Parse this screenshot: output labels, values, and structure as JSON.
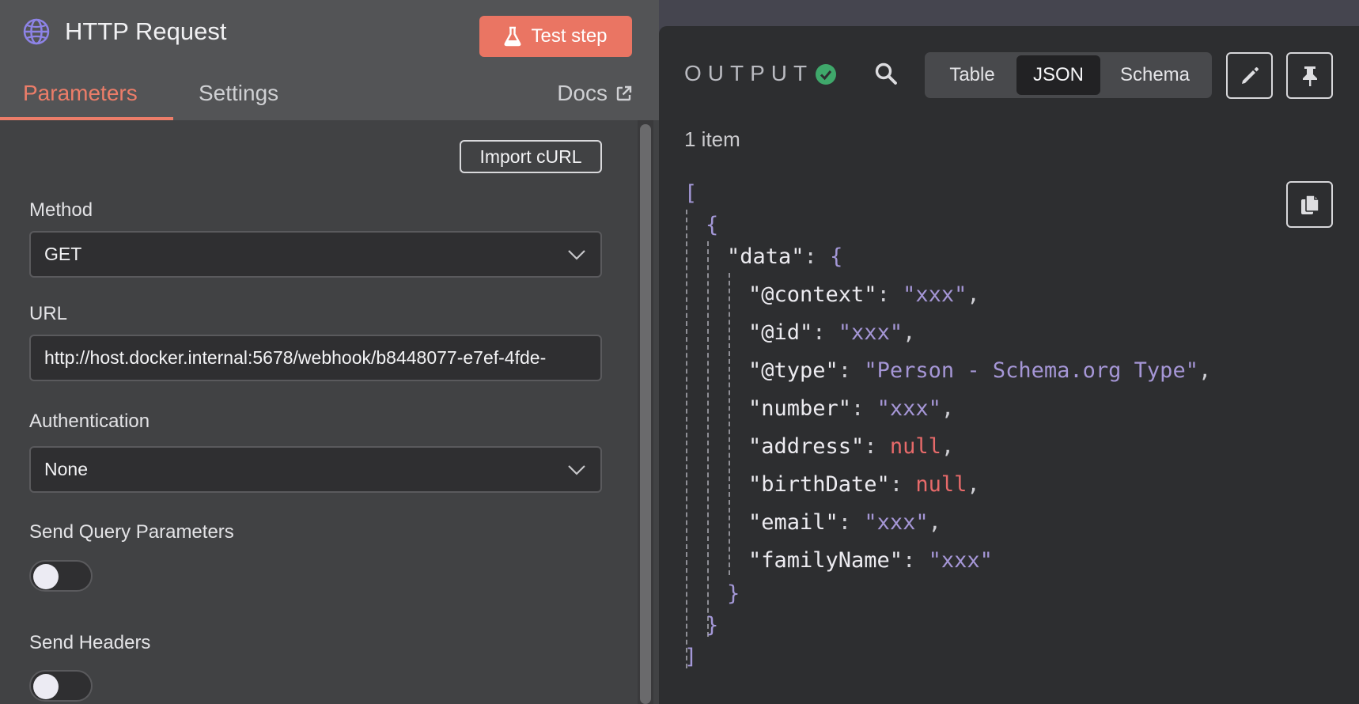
{
  "node": {
    "title": "HTTP Request",
    "test_button": "Test step",
    "tabs": {
      "parameters": "Parameters",
      "settings": "Settings",
      "docs": "Docs"
    }
  },
  "params": {
    "import_curl": "Import cURL",
    "method_label": "Method",
    "method_value": "GET",
    "url_label": "URL",
    "url_value": "http://host.docker.internal:5678/webhook/b8448077-e7ef-4fde-",
    "auth_label": "Authentication",
    "auth_value": "None",
    "query_label": "Send Query Parameters",
    "headers_label": "Send Headers"
  },
  "output": {
    "label": "OUTPUT",
    "views": {
      "table": "Table",
      "json": "JSON",
      "schema": "Schema"
    },
    "selected_view": "JSON",
    "items_count": "1 item",
    "json": {
      "open_array": "[",
      "close_array": "]",
      "open_obj": "{",
      "close_obj": "}",
      "data_key": "\"data\"",
      "rows": [
        {
          "key": "\"@context\"",
          "value": "\"xxx\"",
          "kind": "str",
          "comma": ","
        },
        {
          "key": "\"@id\"",
          "value": "\"xxx\"",
          "kind": "str",
          "comma": ","
        },
        {
          "key": "\"@type\"",
          "value": "\"Person - Schema.org Type\"",
          "kind": "str",
          "comma": ","
        },
        {
          "key": "\"number\"",
          "value": "\"xxx\"",
          "kind": "str",
          "comma": ","
        },
        {
          "key": "\"address\"",
          "value": "null",
          "kind": "nul",
          "comma": ","
        },
        {
          "key": "\"birthDate\"",
          "value": "null",
          "kind": "nul",
          "comma": ","
        },
        {
          "key": "\"email\"",
          "value": "\"xxx\"",
          "kind": "str",
          "comma": ","
        },
        {
          "key": "\"familyName\"",
          "value": "\"xxx\"",
          "kind": "str",
          "comma": ""
        }
      ]
    }
  },
  "colors": {
    "accent": "#ea7563",
    "success": "#3fa86b",
    "json_string": "#a596d6",
    "json_null": "#e76a6a"
  }
}
